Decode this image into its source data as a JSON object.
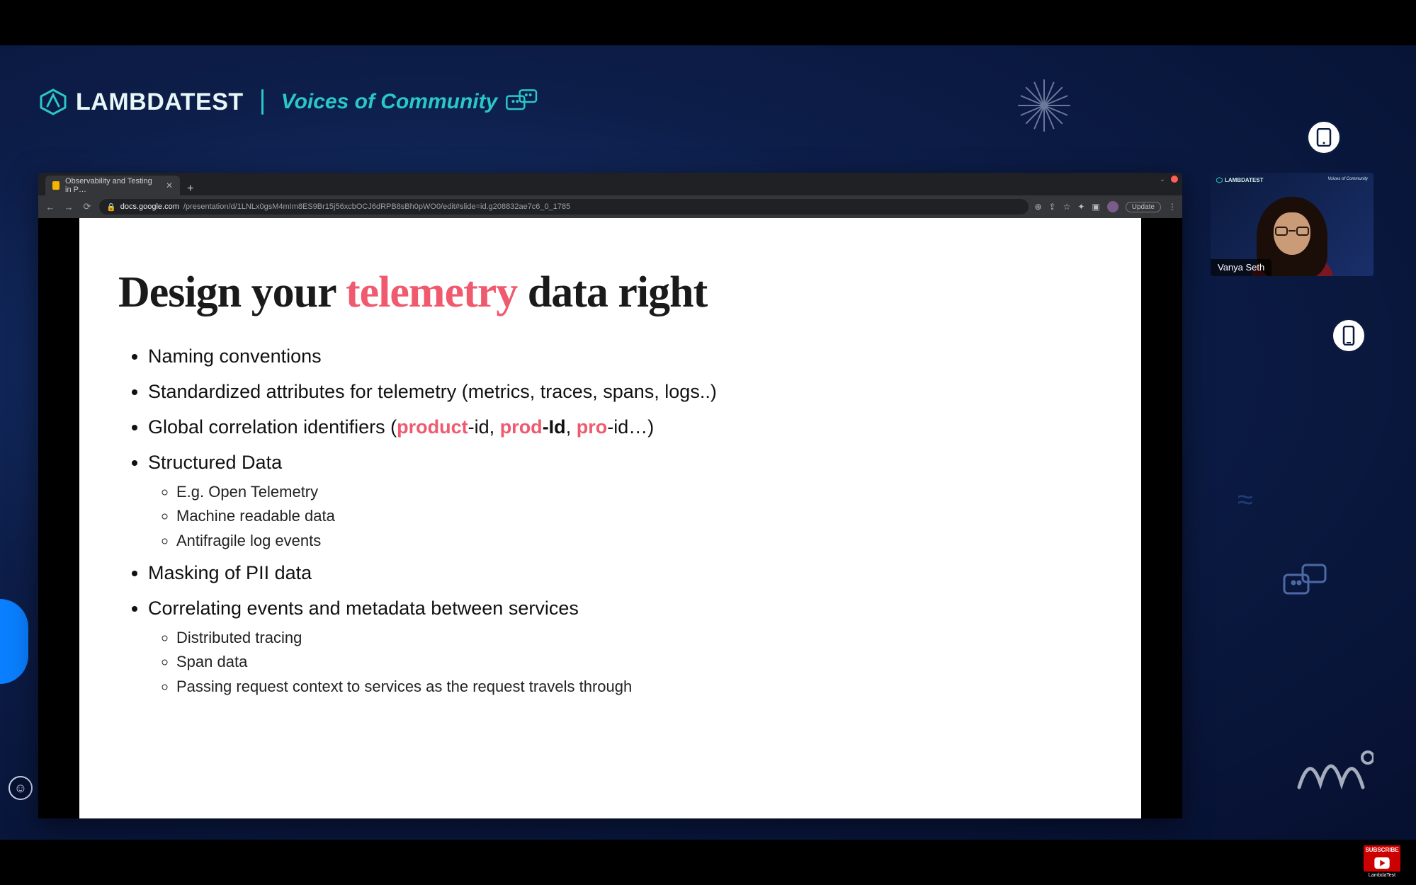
{
  "brand": {
    "name": "LAMBDATEST",
    "series": "Voices of Community"
  },
  "browser": {
    "tab_title": "Observability and Testing in P…",
    "url_host": "docs.google.com",
    "url_path": "/presentation/d/1LNLx0gsM4mIm8ES9Br15j56xcbOCJ6dRPB8sBh0pWO0/edit#slide=id.g208832ae7c6_0_1785",
    "update_label": "Update"
  },
  "slide": {
    "title_pre": "Design your ",
    "title_accent": "telemetry",
    "title_post": " data right",
    "bullets": {
      "b1": "Naming conventions",
      "b2": "Standardized attributes for telemetry  (metrics, traces, spans, logs..)",
      "b3_pre": "Global correlation identifiers (",
      "b3_h1": "product",
      "b3_m1": "-id, ",
      "b3_h2": "prod",
      "b3_m2": "-Id",
      "b3_m2b": ", ",
      "b3_h3": "pro",
      "b3_m3": "-id…)",
      "b4": "Structured Data",
      "b4s1": "E.g. Open Telemetry",
      "b4s2": "Machine readable data",
      "b4s3": "Antifragile log events",
      "b5": "Masking of PII data",
      "b6": "Correlating events and metadata between services",
      "b6s1": "Distributed tracing",
      "b6s2": "Span data",
      "b6s3": "Passing request context to services as the request travels through"
    }
  },
  "webcam": {
    "speaker": "Vanya Seth",
    "brand": "LAMBDATEST",
    "sub": "Voices of Community"
  },
  "subscribe": {
    "label": "SUBSCRIBE",
    "channel": "LambdaTest"
  }
}
